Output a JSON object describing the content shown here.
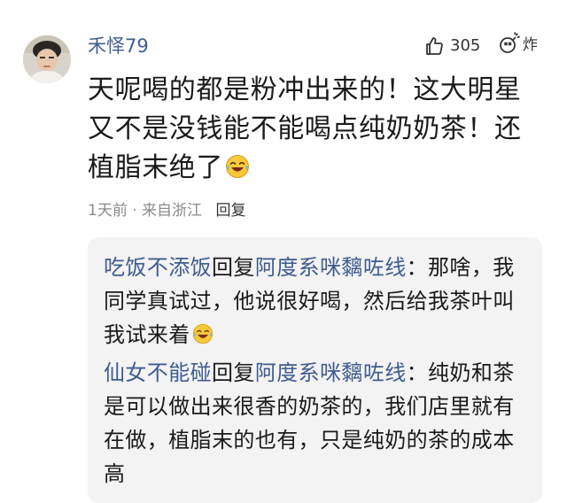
{
  "comment": {
    "username": "禾怿79",
    "like_count": "305",
    "explode_label": "炸",
    "text": "天呢喝的都是粉冲出来的！这大明星又不是没钱能不能喝点纯奶奶茶！还植脂末绝了",
    "emoji_icon": "laugh-cry-emoji-icon",
    "time": "1天前",
    "separator": "·",
    "location": "来自浙江",
    "reply_label": "回复"
  },
  "replies": [
    {
      "author": "吃饭不添饭",
      "verb": "回复",
      "target": "阿度系咪黐咗线",
      "colon": "：",
      "text": "那啥，我同学真试过，他说很好喝，然后给我茶叶叫我试来着",
      "emoji_icon": "laugh-cry-emoji-icon"
    },
    {
      "author": "仙女不能碰",
      "verb": "回复",
      "target": "阿度系咪黐咗线",
      "colon": "：",
      "text": "纯奶和茶是可以做出来很香的奶茶的，我们店里就有在做，植脂末的也有，只是纯奶的茶的成本高"
    }
  ],
  "colors": {
    "link_blue": "#3f5c90",
    "meta_gray": "#8a8a8a",
    "reply_panel_bg": "#f3f3f3"
  }
}
